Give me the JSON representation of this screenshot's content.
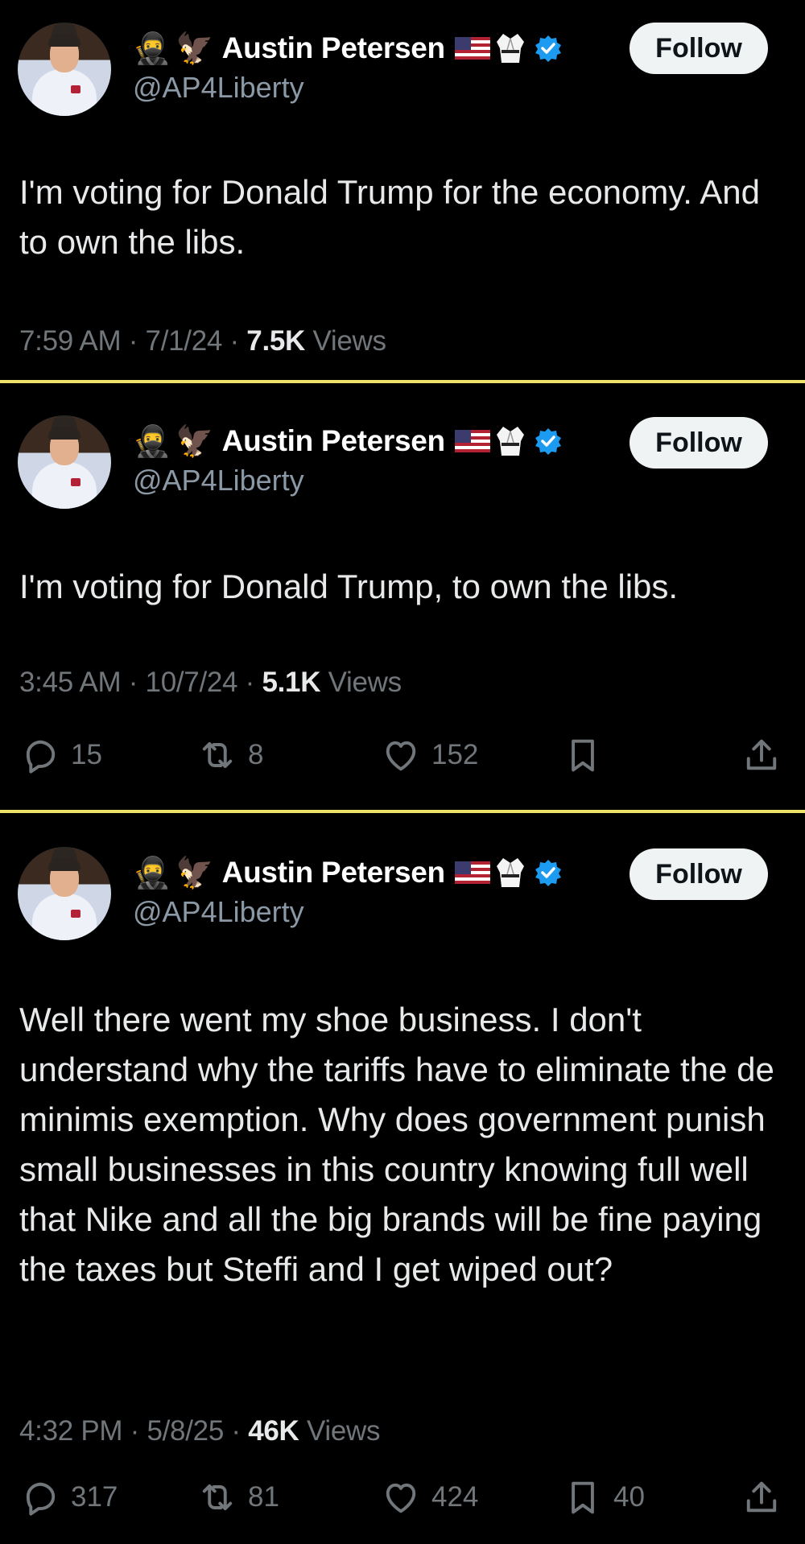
{
  "tweets": [
    {
      "author": {
        "name": "Austin Petersen",
        "handle": "@AP4Liberty",
        "follow_label": "Follow"
      },
      "text": "I'm voting for Donald Trump for the economy. And to own the libs.",
      "meta": {
        "time": "7:59 AM",
        "date": "7/1/24",
        "views": "7.5K",
        "views_label": "Views"
      }
    },
    {
      "author": {
        "name": "Austin Petersen",
        "handle": "@AP4Liberty",
        "follow_label": "Follow"
      },
      "text": "I'm voting for Donald Trump, to own the libs.",
      "meta": {
        "time": "3:45 AM",
        "date": "10/7/24",
        "views": "5.1K",
        "views_label": "Views"
      },
      "stats": {
        "replies": "15",
        "reposts": "8",
        "likes": "152",
        "bookmarks": ""
      }
    },
    {
      "author": {
        "name": "Austin Petersen",
        "handle": "@AP4Liberty",
        "follow_label": "Follow"
      },
      "text": "Well there went my shoe business. I don't understand why the tariffs have to eliminate the de minimis exemption. Why does government punish small businesses in this country knowing full well that Nike and all the big brands will be fine paying the taxes but Steffi and I get wiped out?",
      "meta": {
        "time": "4:32 PM",
        "date": "5/8/25",
        "views": "46K",
        "views_label": "Views"
      },
      "stats": {
        "replies": "317",
        "reposts": "81",
        "likes": "424",
        "bookmarks": "40"
      }
    }
  ],
  "icons": [
    "ninja-emoji",
    "eagle-emoji",
    "us-flag-emoji",
    "martial-arts-uniform-emoji",
    "verified-badge-icon",
    "reply-icon",
    "repost-icon",
    "like-icon",
    "bookmark-icon",
    "share-icon"
  ],
  "colors": {
    "background": "#000000",
    "divider": "#ede36a",
    "verified": "#1d9bf0",
    "muted": "#71767b",
    "text": "#e7e9ea"
  }
}
